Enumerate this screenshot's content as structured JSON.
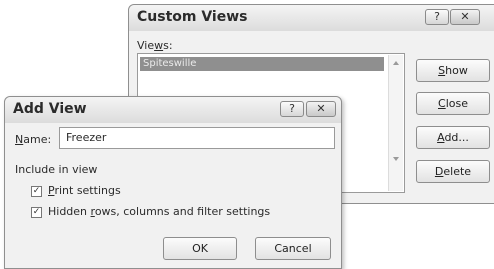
{
  "custom_views": {
    "title": "Custom Views",
    "help_icon": "?",
    "close_icon": "✕",
    "views_label_pre": "Vie",
    "views_label_u": "w",
    "views_label_post": "s:",
    "views": [
      "Spiteswille"
    ],
    "buttons": {
      "show_u": "S",
      "show_rest": "how",
      "close_u": "C",
      "close_rest": "lose",
      "add_u": "A",
      "add_rest": "dd...",
      "delete_u": "D",
      "delete_rest": "elete"
    }
  },
  "add_view": {
    "title": "Add View",
    "help_icon": "?",
    "close_icon": "✕",
    "name_label_u": "N",
    "name_label_rest": "ame:",
    "name_value": "Freezer",
    "include_label": "Include in view",
    "print_settings": {
      "u": "P",
      "rest": "rint settings",
      "checked": true
    },
    "hidden_settings": {
      "pre": "Hidden ",
      "u": "r",
      "rest": "ows, columns and filter settings",
      "checked": true
    },
    "ok_label": "OK",
    "cancel_label": "Cancel"
  }
}
